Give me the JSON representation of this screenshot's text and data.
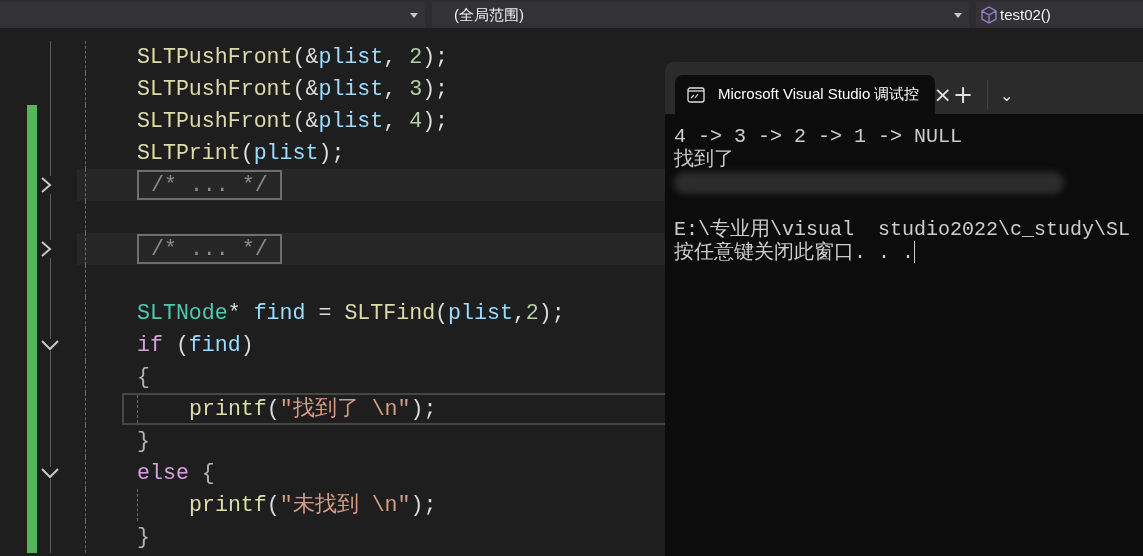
{
  "toolbar": {
    "dropdowns": [
      {
        "kind": "plain"
      },
      {
        "kind": "plain",
        "label": "(全局范围)"
      },
      {
        "kind": "function",
        "label": "test02()"
      }
    ]
  },
  "editor": {
    "lines": [
      {
        "kind": "code",
        "changed": false,
        "current": false,
        "tokens": [
          {
            "kind": "fn",
            "text": "SLTPushFront"
          },
          {
            "kind": "punct",
            "text": "(&"
          },
          {
            "kind": "var",
            "text": "plist"
          },
          {
            "kind": "punct",
            "text": ", "
          },
          {
            "kind": "num",
            "text": "2"
          },
          {
            "kind": "punct",
            "text": ");"
          }
        ]
      },
      {
        "kind": "code",
        "changed": false,
        "current": false,
        "tokens": [
          {
            "kind": "fn",
            "text": "SLTPushFront"
          },
          {
            "kind": "punct",
            "text": "(&"
          },
          {
            "kind": "var",
            "text": "plist"
          },
          {
            "kind": "punct",
            "text": ", "
          },
          {
            "kind": "num",
            "text": "3"
          },
          {
            "kind": "punct",
            "text": ");"
          }
        ]
      },
      {
        "kind": "code",
        "changed": true,
        "current": false,
        "tokens": [
          {
            "kind": "fn",
            "text": "SLTPushFront"
          },
          {
            "kind": "punct",
            "text": "(&"
          },
          {
            "kind": "var",
            "text": "plist"
          },
          {
            "kind": "punct",
            "text": ", "
          },
          {
            "kind": "num",
            "text": "4"
          },
          {
            "kind": "punct",
            "text": ");"
          }
        ]
      },
      {
        "kind": "code",
        "changed": true,
        "current": false,
        "tokens": [
          {
            "kind": "fn",
            "text": "SLTPrint"
          },
          {
            "kind": "punct",
            "text": "("
          },
          {
            "kind": "var",
            "text": "plist"
          },
          {
            "kind": "punct",
            "text": ");"
          }
        ]
      },
      {
        "kind": "code",
        "changed": true,
        "current": false,
        "fold": {
          "expanded": false
        },
        "tokens": [
          {
            "kind": "folded",
            "text": "/* ... */"
          }
        ]
      },
      {
        "kind": "code",
        "changed": true,
        "current": false
      },
      {
        "kind": "code",
        "changed": true,
        "current": false,
        "fold": {
          "expanded": false
        },
        "tokens": [
          {
            "kind": "folded",
            "text": "/* ... */"
          }
        ]
      },
      {
        "kind": "code",
        "changed": true,
        "current": false
      },
      {
        "kind": "code",
        "changed": true,
        "current": false,
        "tokens": [
          {
            "kind": "type",
            "text": "SLTNode"
          },
          {
            "kind": "punct",
            "text": "* "
          },
          {
            "kind": "var",
            "text": "find"
          },
          {
            "kind": "punct",
            "text": " = "
          },
          {
            "kind": "fn",
            "text": "SLTFind"
          },
          {
            "kind": "punct",
            "text": "("
          },
          {
            "kind": "var",
            "text": "plist"
          },
          {
            "kind": "punct",
            "text": ","
          },
          {
            "kind": "num",
            "text": "2"
          },
          {
            "kind": "punct",
            "text": ");"
          }
        ]
      },
      {
        "kind": "code",
        "changed": true,
        "current": false,
        "fold": {
          "expanded": true
        },
        "tokens": [
          {
            "kind": "kw",
            "text": "if"
          },
          {
            "kind": "punct",
            "text": " ("
          },
          {
            "kind": "var",
            "text": "find"
          },
          {
            "kind": "punct",
            "text": ")"
          }
        ]
      },
      {
        "kind": "code",
        "changed": true,
        "current": false,
        "tokens": [
          {
            "kind": "brace",
            "text": "{"
          }
        ]
      },
      {
        "kind": "indented",
        "changed": true,
        "current": true,
        "tokens": [
          {
            "kind": "fn",
            "text": "printf"
          },
          {
            "kind": "punct",
            "text": "("
          },
          {
            "kind": "str",
            "text": "\"找到了 \\n\""
          },
          {
            "kind": "punct",
            "text": ");"
          }
        ]
      },
      {
        "kind": "code",
        "changed": true,
        "current": false,
        "tokens": [
          {
            "kind": "brace",
            "text": "}"
          }
        ]
      },
      {
        "kind": "code",
        "changed": true,
        "current": false,
        "fold": {
          "expanded": true
        },
        "tokens": [
          {
            "kind": "kw",
            "text": "else"
          },
          {
            "kind": "brace",
            "text": " {"
          }
        ]
      },
      {
        "kind": "indented",
        "changed": true,
        "current": false,
        "tokens": [
          {
            "kind": "fn",
            "text": "printf"
          },
          {
            "kind": "punct",
            "text": "("
          },
          {
            "kind": "str",
            "text": "\"未找到 \\n\""
          },
          {
            "kind": "punct",
            "text": ");"
          }
        ]
      },
      {
        "kind": "code",
        "changed": true,
        "current": false,
        "tokens": [
          {
            "kind": "brace",
            "text": "}"
          }
        ]
      }
    ]
  },
  "console": {
    "tab": {
      "title": "Microsoft Visual Studio 调试控",
      "close": "×"
    },
    "new_tab": "+",
    "menu": "⌄",
    "lines": [
      {
        "kind": "text",
        "text": "4 -> 3 -> 2 -> 1 -> NULL"
      },
      {
        "kind": "text",
        "text": "找到了"
      },
      {
        "kind": "blurred"
      },
      {
        "kind": "blank"
      },
      {
        "kind": "text",
        "text": "E:\\专业用\\visual  studio2022\\c_study\\SL"
      },
      {
        "kind": "prompt",
        "text": "按任意键关闭此窗口. . ."
      }
    ]
  }
}
